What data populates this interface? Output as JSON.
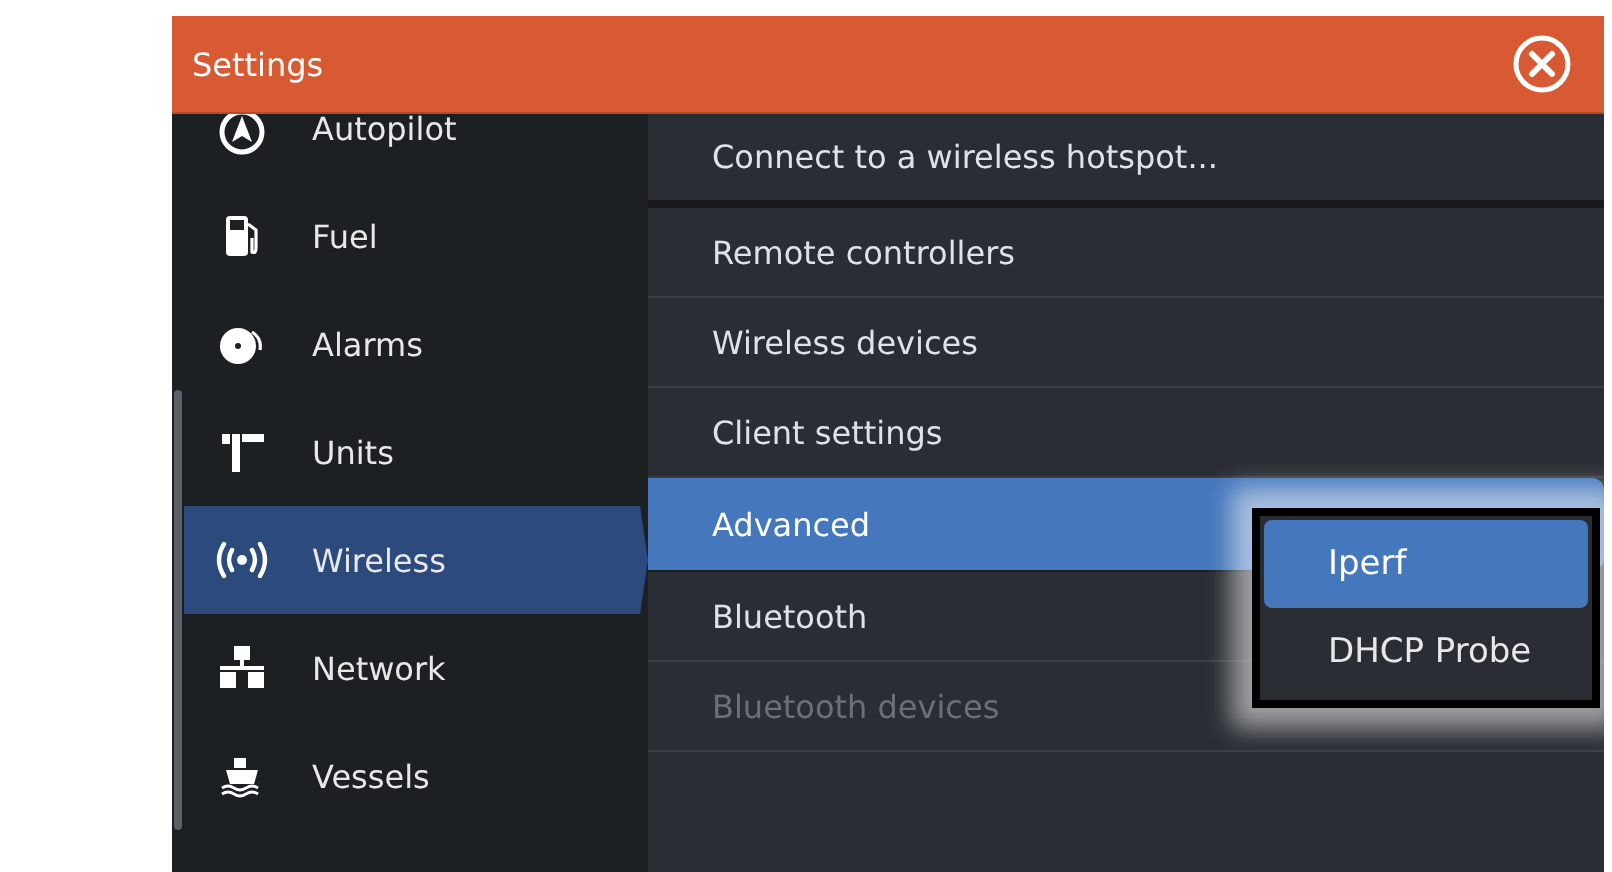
{
  "window": {
    "title": "Settings"
  },
  "sidebar": {
    "items": [
      {
        "label": "Autopilot",
        "selected": false
      },
      {
        "label": "Fuel",
        "selected": false
      },
      {
        "label": "Alarms",
        "selected": false
      },
      {
        "label": "Units",
        "selected": false
      },
      {
        "label": "Wireless",
        "selected": true
      },
      {
        "label": "Network",
        "selected": false
      },
      {
        "label": "Vessels",
        "selected": false
      }
    ]
  },
  "menu": {
    "items": [
      {
        "label": "Connect to a wireless hotspot...",
        "selected": false,
        "disabled": false
      },
      {
        "label": "Remote controllers",
        "selected": false,
        "disabled": false
      },
      {
        "label": "Wireless devices",
        "selected": false,
        "disabled": false
      },
      {
        "label": "Client settings",
        "selected": false,
        "disabled": false
      },
      {
        "label": "Advanced",
        "selected": true,
        "disabled": false
      },
      {
        "label": "Bluetooth",
        "selected": false,
        "disabled": false
      },
      {
        "label": "Bluetooth devices",
        "selected": false,
        "disabled": true
      }
    ]
  },
  "submenu": {
    "items": [
      {
        "label": "Iperf",
        "selected": true
      },
      {
        "label": "DHCP Probe",
        "selected": false
      }
    ]
  }
}
